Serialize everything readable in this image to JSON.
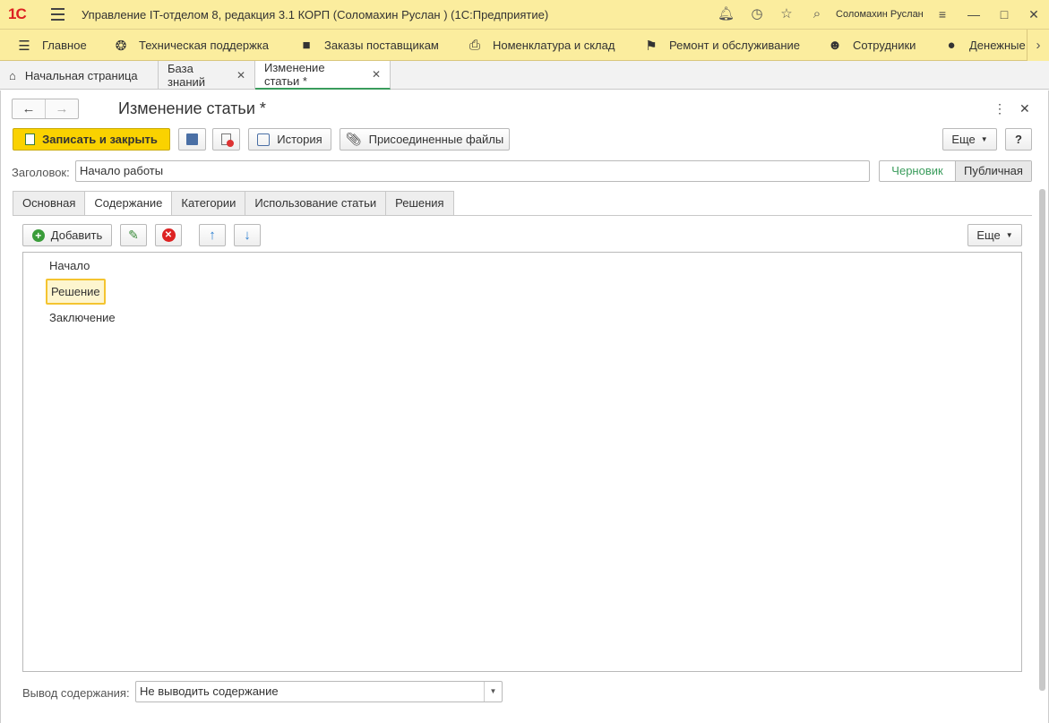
{
  "titlebar": {
    "logo": "1С",
    "app_title": "Управление IT-отделом 8, редакция 3.1 КОРП (Соломахин Руслан )  (1С:Предприятие)",
    "user": "Соломахин Руслан"
  },
  "sections": [
    {
      "label": "Главное",
      "icon": "menu-icon"
    },
    {
      "label": "Техническая поддержка",
      "icon": "lifebuoy-icon"
    },
    {
      "label": "Заказы поставщикам",
      "icon": "truck-icon"
    },
    {
      "label": "Номенклатура и склад",
      "icon": "printer-icon"
    },
    {
      "label": "Ремонт и обслуживание",
      "icon": "checkered-flag-icon"
    },
    {
      "label": "Сотрудники",
      "icon": "people-icon"
    },
    {
      "label": "Денежные",
      "icon": "money-bag-icon"
    }
  ],
  "window_tabs": [
    {
      "label": "Начальная страница"
    },
    {
      "label": "База знаний"
    },
    {
      "label": "Изменение статьи *"
    }
  ],
  "form": {
    "title": "Изменение статьи *",
    "buttons": {
      "save_close": "Записать и закрыть",
      "history": "История",
      "attached": "Присоединенные файлы",
      "more": "Еще",
      "help": "?"
    },
    "heading_label": "Заголовок:",
    "heading_value": "Начало работы",
    "status": {
      "draft": "Черновик",
      "public": "Публичная"
    },
    "tabs": [
      "Основная",
      "Содержание",
      "Категории",
      "Использование статьи",
      "Решения"
    ],
    "content": {
      "add": "Добавить",
      "more": "Еще",
      "items": [
        "Начало",
        "Решение",
        "Заключение"
      ],
      "output_label": "Вывод содержания:",
      "output_value": "Не выводить содержание"
    }
  }
}
